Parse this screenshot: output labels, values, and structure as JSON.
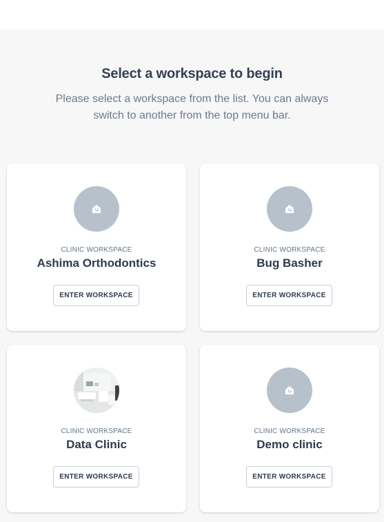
{
  "page": {
    "heading": "Select a workspace to begin",
    "subtext": "Please select a workspace from the list. You can always switch to another from the top menu bar."
  },
  "colors": {
    "background": "#f7f7f7",
    "card": "#ffffff",
    "avatar_placeholder": "#b7c1cc",
    "heading": "#344154",
    "muted": "#6b7a90"
  },
  "workspaces": [
    {
      "type_label": "CLINIC WORKSPACE",
      "name": "Ashima Orthodontics",
      "button_label": "ENTER WORKSPACE",
      "avatar_icon": "clinic-icon"
    },
    {
      "type_label": "CLINIC WORKSPACE",
      "name": "Bug Basher",
      "button_label": "ENTER WORKSPACE",
      "avatar_icon": "clinic-icon"
    },
    {
      "type_label": "CLINIC WORKSPACE",
      "name": "Data Clinic",
      "button_label": "ENTER WORKSPACE",
      "avatar_icon": "clinic-photo"
    },
    {
      "type_label": "CLINIC WORKSPACE",
      "name": "Demo clinic",
      "button_label": "ENTER WORKSPACE",
      "avatar_icon": "clinic-icon"
    }
  ]
}
